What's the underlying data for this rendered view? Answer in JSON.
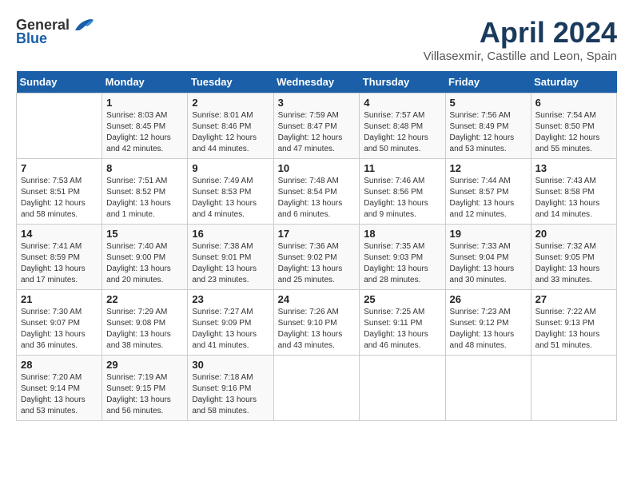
{
  "header": {
    "logo_general": "General",
    "logo_blue": "Blue",
    "title": "April 2024",
    "subtitle": "Villasexmir, Castille and Leon, Spain"
  },
  "calendar": {
    "days_of_week": [
      "Sunday",
      "Monday",
      "Tuesday",
      "Wednesday",
      "Thursday",
      "Friday",
      "Saturday"
    ],
    "weeks": [
      [
        {
          "day": "",
          "info": ""
        },
        {
          "day": "1",
          "info": "Sunrise: 8:03 AM\nSunset: 8:45 PM\nDaylight: 12 hours\nand 42 minutes."
        },
        {
          "day": "2",
          "info": "Sunrise: 8:01 AM\nSunset: 8:46 PM\nDaylight: 12 hours\nand 44 minutes."
        },
        {
          "day": "3",
          "info": "Sunrise: 7:59 AM\nSunset: 8:47 PM\nDaylight: 12 hours\nand 47 minutes."
        },
        {
          "day": "4",
          "info": "Sunrise: 7:57 AM\nSunset: 8:48 PM\nDaylight: 12 hours\nand 50 minutes."
        },
        {
          "day": "5",
          "info": "Sunrise: 7:56 AM\nSunset: 8:49 PM\nDaylight: 12 hours\nand 53 minutes."
        },
        {
          "day": "6",
          "info": "Sunrise: 7:54 AM\nSunset: 8:50 PM\nDaylight: 12 hours\nand 55 minutes."
        }
      ],
      [
        {
          "day": "7",
          "info": "Sunrise: 7:53 AM\nSunset: 8:51 PM\nDaylight: 12 hours\nand 58 minutes."
        },
        {
          "day": "8",
          "info": "Sunrise: 7:51 AM\nSunset: 8:52 PM\nDaylight: 13 hours\nand 1 minute."
        },
        {
          "day": "9",
          "info": "Sunrise: 7:49 AM\nSunset: 8:53 PM\nDaylight: 13 hours\nand 4 minutes."
        },
        {
          "day": "10",
          "info": "Sunrise: 7:48 AM\nSunset: 8:54 PM\nDaylight: 13 hours\nand 6 minutes."
        },
        {
          "day": "11",
          "info": "Sunrise: 7:46 AM\nSunset: 8:56 PM\nDaylight: 13 hours\nand 9 minutes."
        },
        {
          "day": "12",
          "info": "Sunrise: 7:44 AM\nSunset: 8:57 PM\nDaylight: 13 hours\nand 12 minutes."
        },
        {
          "day": "13",
          "info": "Sunrise: 7:43 AM\nSunset: 8:58 PM\nDaylight: 13 hours\nand 14 minutes."
        }
      ],
      [
        {
          "day": "14",
          "info": "Sunrise: 7:41 AM\nSunset: 8:59 PM\nDaylight: 13 hours\nand 17 minutes."
        },
        {
          "day": "15",
          "info": "Sunrise: 7:40 AM\nSunset: 9:00 PM\nDaylight: 13 hours\nand 20 minutes."
        },
        {
          "day": "16",
          "info": "Sunrise: 7:38 AM\nSunset: 9:01 PM\nDaylight: 13 hours\nand 23 minutes."
        },
        {
          "day": "17",
          "info": "Sunrise: 7:36 AM\nSunset: 9:02 PM\nDaylight: 13 hours\nand 25 minutes."
        },
        {
          "day": "18",
          "info": "Sunrise: 7:35 AM\nSunset: 9:03 PM\nDaylight: 13 hours\nand 28 minutes."
        },
        {
          "day": "19",
          "info": "Sunrise: 7:33 AM\nSunset: 9:04 PM\nDaylight: 13 hours\nand 30 minutes."
        },
        {
          "day": "20",
          "info": "Sunrise: 7:32 AM\nSunset: 9:05 PM\nDaylight: 13 hours\nand 33 minutes."
        }
      ],
      [
        {
          "day": "21",
          "info": "Sunrise: 7:30 AM\nSunset: 9:07 PM\nDaylight: 13 hours\nand 36 minutes."
        },
        {
          "day": "22",
          "info": "Sunrise: 7:29 AM\nSunset: 9:08 PM\nDaylight: 13 hours\nand 38 minutes."
        },
        {
          "day": "23",
          "info": "Sunrise: 7:27 AM\nSunset: 9:09 PM\nDaylight: 13 hours\nand 41 minutes."
        },
        {
          "day": "24",
          "info": "Sunrise: 7:26 AM\nSunset: 9:10 PM\nDaylight: 13 hours\nand 43 minutes."
        },
        {
          "day": "25",
          "info": "Sunrise: 7:25 AM\nSunset: 9:11 PM\nDaylight: 13 hours\nand 46 minutes."
        },
        {
          "day": "26",
          "info": "Sunrise: 7:23 AM\nSunset: 9:12 PM\nDaylight: 13 hours\nand 48 minutes."
        },
        {
          "day": "27",
          "info": "Sunrise: 7:22 AM\nSunset: 9:13 PM\nDaylight: 13 hours\nand 51 minutes."
        }
      ],
      [
        {
          "day": "28",
          "info": "Sunrise: 7:20 AM\nSunset: 9:14 PM\nDaylight: 13 hours\nand 53 minutes."
        },
        {
          "day": "29",
          "info": "Sunrise: 7:19 AM\nSunset: 9:15 PM\nDaylight: 13 hours\nand 56 minutes."
        },
        {
          "day": "30",
          "info": "Sunrise: 7:18 AM\nSunset: 9:16 PM\nDaylight: 13 hours\nand 58 minutes."
        },
        {
          "day": "",
          "info": ""
        },
        {
          "day": "",
          "info": ""
        },
        {
          "day": "",
          "info": ""
        },
        {
          "day": "",
          "info": ""
        }
      ]
    ]
  }
}
